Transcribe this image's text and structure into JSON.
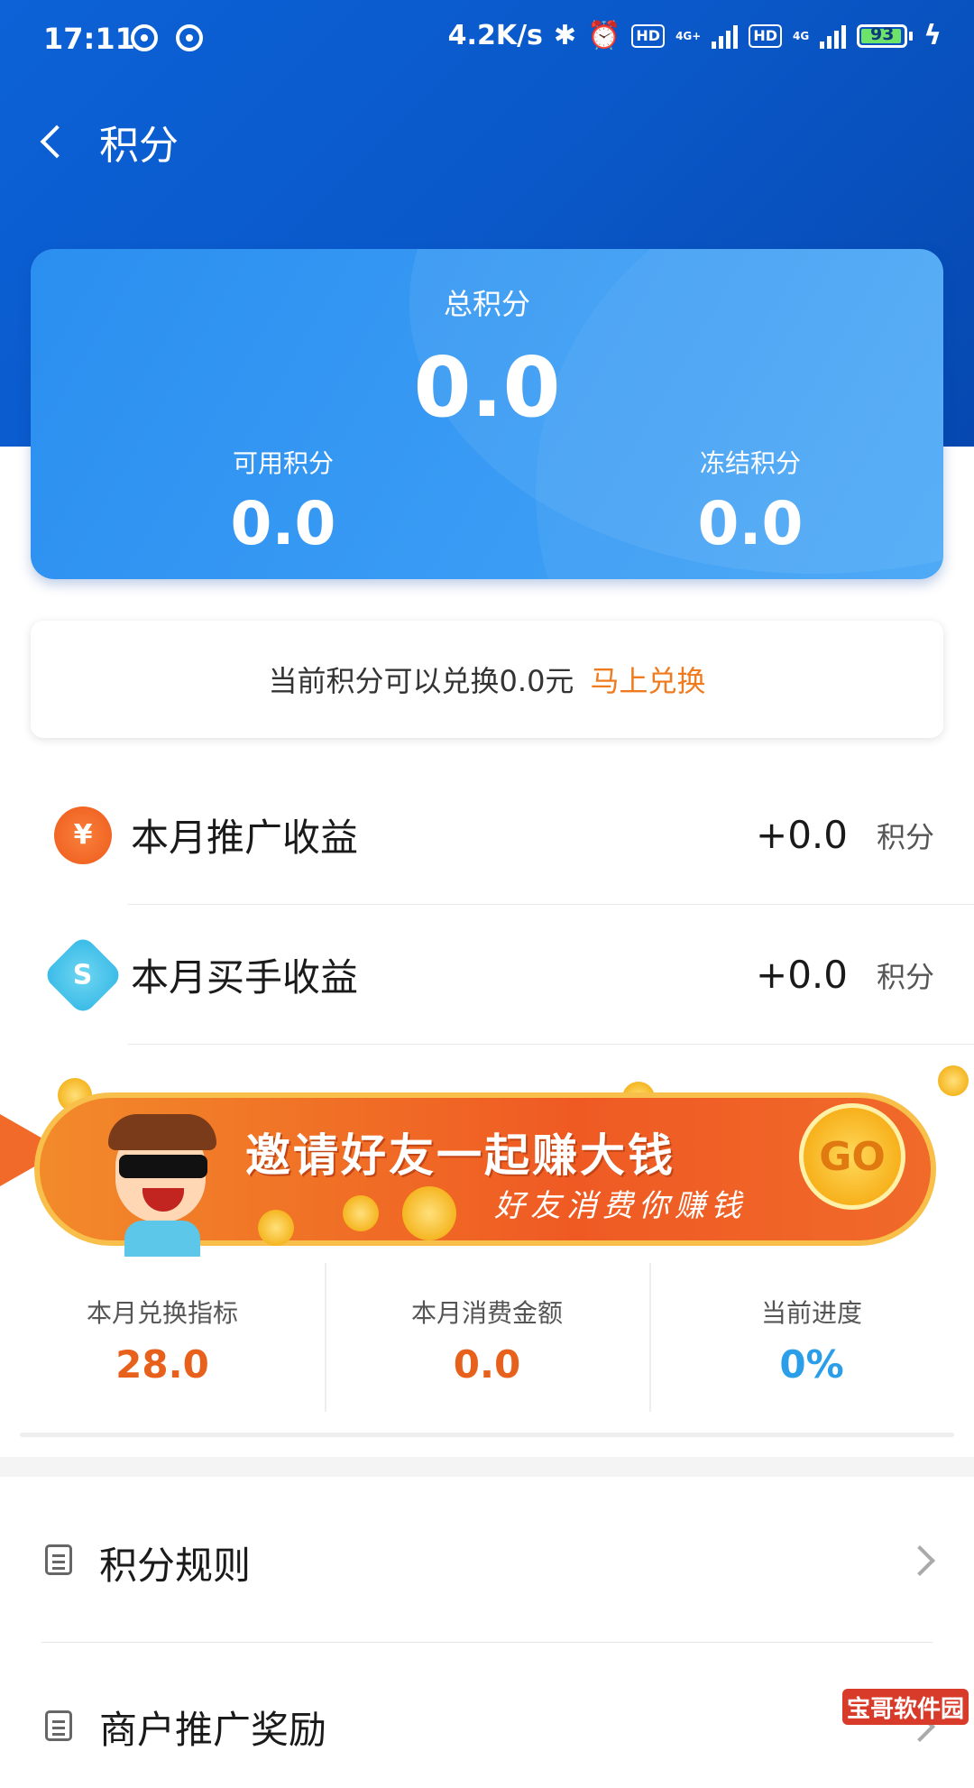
{
  "status_bar": {
    "time": "17:11",
    "net_speed": "4.2K/s",
    "hd1": "HD",
    "net1": "4G+",
    "hd2": "HD",
    "net2": "4G",
    "battery": "93"
  },
  "nav": {
    "title": "积分"
  },
  "points_card": {
    "total_label": "总积分",
    "total_value": "0.0",
    "available_label": "可用积分",
    "available_value": "0.0",
    "frozen_label": "冻结积分",
    "frozen_value": "0.0"
  },
  "redeem": {
    "text": "当前积分可以兑换0.0元",
    "link": "马上兑换"
  },
  "earnings": [
    {
      "label": "本月推广收益",
      "value": "+0.0",
      "unit": "积分",
      "icon": "fire-yuan-icon",
      "icon_glyph": "¥"
    },
    {
      "label": "本月买手收益",
      "value": "+0.0",
      "unit": "积分",
      "icon": "buyer-badge-icon",
      "icon_glyph": "S"
    }
  ],
  "banner": {
    "title": "邀请好友一起赚大钱",
    "subtitle": "好友消费你赚钱",
    "button": "GO"
  },
  "stats": [
    {
      "label": "本月兑换指标",
      "value": "28.0",
      "color": "#e8611c"
    },
    {
      "label": "本月消费金额",
      "value": "0.0",
      "color": "#e8611c"
    },
    {
      "label": "当前进度",
      "value": "0%",
      "color": "#2a9ee8"
    }
  ],
  "menu": [
    {
      "label": "积分规则",
      "icon": "rules-icon"
    },
    {
      "label": "商户推广奖励",
      "icon": "merchant-icon"
    }
  ],
  "watermark": "宝哥软件园",
  "colors": {
    "header_blue": "#0a58c9",
    "card_blue": "#3a9cf4",
    "accent_orange": "#f07a1e",
    "progress_blue": "#2a9ee8"
  }
}
